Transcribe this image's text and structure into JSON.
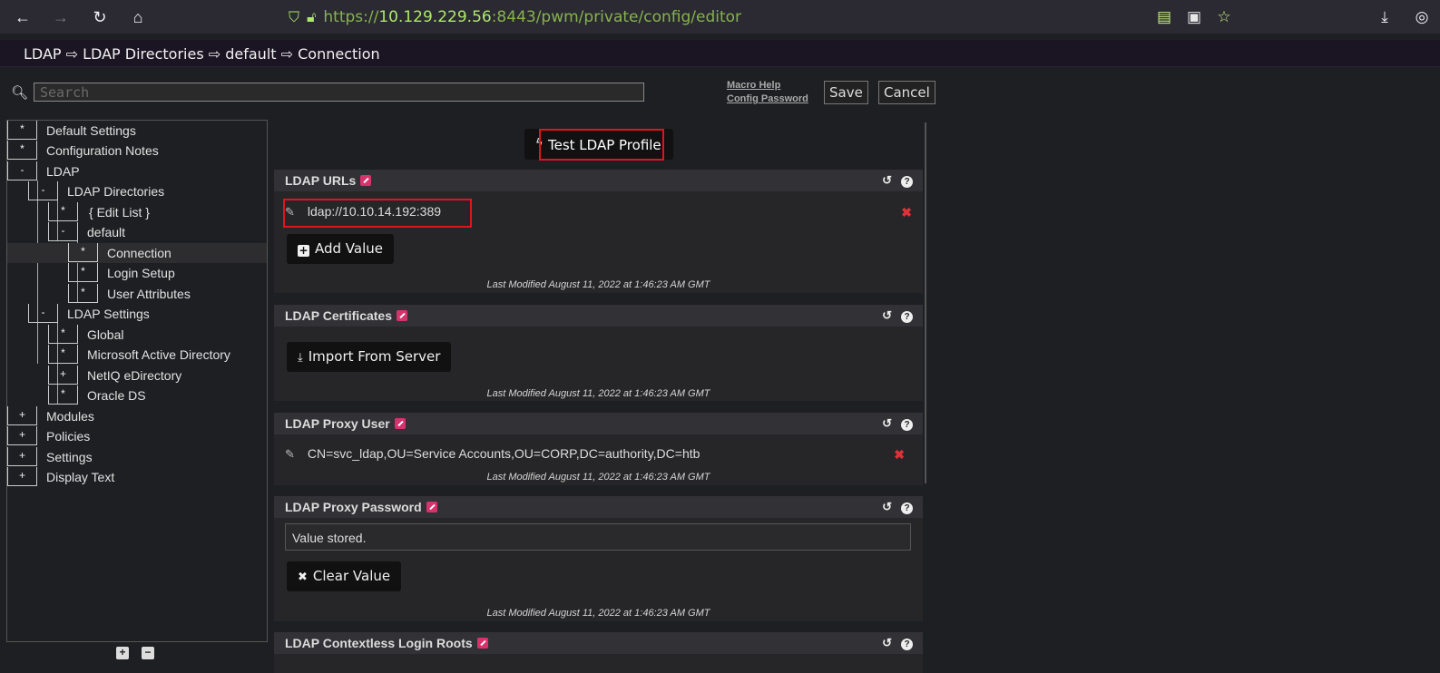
{
  "browser": {
    "url_prefix": "https://",
    "url_host": "10.129.229.56",
    "url_rest": ":8443/pwm/private/config/editor"
  },
  "breadcrumb": "LDAP ⇨ LDAP Directories ⇨ default ⇨ Connection",
  "search": {
    "placeholder": "Search",
    "value": ""
  },
  "header_links": {
    "macro_help": "Macro Help",
    "config_password": "Config Password"
  },
  "header_buttons": {
    "save": "Save",
    "cancel": "Cancel"
  },
  "tree": {
    "default_settings": {
      "marker": "*",
      "label": "Default Settings"
    },
    "configuration_notes": {
      "marker": "*",
      "label": "Configuration Notes"
    },
    "ldap": {
      "marker": "-",
      "label": "LDAP"
    },
    "ldap_directories": {
      "marker": "-",
      "label": "LDAP Directories"
    },
    "edit_list": {
      "marker": "*",
      "label": "{ Edit List }"
    },
    "default": {
      "marker": "-",
      "label": "default"
    },
    "connection": {
      "marker": "*",
      "label": "Connection"
    },
    "login_setup": {
      "marker": "*",
      "label": "Login Setup"
    },
    "user_attributes": {
      "marker": "*",
      "label": "User Attributes"
    },
    "ldap_settings": {
      "marker": "-",
      "label": "LDAP Settings"
    },
    "global": {
      "marker": "*",
      "label": "Global"
    },
    "microsoft_ad": {
      "marker": "*",
      "label": "Microsoft Active Directory"
    },
    "netiq": {
      "marker": "+",
      "label": "NetIQ eDirectory"
    },
    "oracle_ds": {
      "marker": "*",
      "label": "Oracle DS"
    },
    "modules": {
      "marker": "+",
      "label": "Modules"
    },
    "policies": {
      "marker": "+",
      "label": "Policies"
    },
    "settings": {
      "marker": "+",
      "label": "Settings"
    },
    "display_text": {
      "marker": "+",
      "label": "Display Text"
    }
  },
  "test_button": "Test LDAP Profile",
  "panels": {
    "ldap_urls": {
      "title": "LDAP URLs",
      "value": "ldap://10.10.14.192:389",
      "button": "Add Value",
      "modified": "Last Modified August 11, 2022 at 1:46:23 AM GMT"
    },
    "ldap_certificates": {
      "title": "LDAP Certificates",
      "button": "Import From Server",
      "modified": "Last Modified August 11, 2022 at 1:46:23 AM GMT"
    },
    "ldap_proxy_user": {
      "title": "LDAP Proxy User",
      "value": "CN=svc_ldap,OU=Service Accounts,OU=CORP,DC=authority,DC=htb",
      "modified": "Last Modified August 11, 2022 at 1:46:23 AM GMT"
    },
    "ldap_proxy_password": {
      "title": "LDAP Proxy Password",
      "value": "Value stored.",
      "button": "Clear Value",
      "modified": "Last Modified August 11, 2022 at 1:46:23 AM GMT"
    },
    "ldap_contextless": {
      "title": "LDAP Contextless Login Roots"
    }
  },
  "colors": {
    "highlight": "#e0141e",
    "edit_badge": "#d6336c",
    "url_green": "#aee86a"
  }
}
